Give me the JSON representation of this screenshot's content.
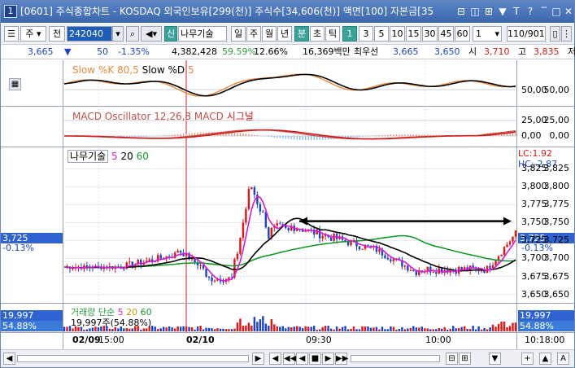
{
  "window": {
    "title_num": "1",
    "title": "[0601] 주식종합차트 - KOSDAQ 외국인보유[299(천)] 주식수[34,606(천)] 액면[100] 자본금[35",
    "buttons": [
      "⊟",
      "◫",
      "⊞",
      "▼",
      "T",
      "?",
      "‾",
      "□",
      "✕"
    ]
  },
  "toolbar": {
    "market": "주",
    "period_label": "전",
    "code": "242040",
    "stock_badge": "신",
    "stock_name": "나무기술",
    "periods": [
      "일",
      "주",
      "월",
      "년",
      "분",
      "초",
      "틱"
    ],
    "period_active": "분",
    "intervals": [
      "1",
      "3",
      "5",
      "10",
      "15",
      "30",
      "45",
      "60"
    ],
    "interval_active": "1",
    "interval_value": "1",
    "bars_shown": "110/901"
  },
  "quote": {
    "price": "3,665",
    "change": "50",
    "change_pct": "-1.35%",
    "volume": "4,382,428",
    "ratio1": "59.59%",
    "ratio2": "12.66%",
    "amount": "16,369백만",
    "priority_label": "최우선",
    "bid1": "3,665",
    "bid2": "3,650",
    "open_label": "시",
    "open": "3,710",
    "high_label": "고",
    "high": "3,835",
    "last_label": "저"
  },
  "colors": {
    "up": "#e0161b",
    "down": "#1a44c8",
    "ma5": "#d61cd0",
    "ma20": "#000000",
    "ma60": "#16992b",
    "stoch_k": "#e88a3a",
    "macd_hist": "#e88a6a",
    "macd_signal": "#d41818",
    "tag_bg": "#2f63d1"
  },
  "stochastic": {
    "legend_name": "Slow %K",
    "legend_k_param": "80,5",
    "legend_d": "Slow %D",
    "legend_d_param": "5",
    "tick_left": "50,00",
    "tick_right": "50,00"
  },
  "macd": {
    "legend": "MACD Oscillator 12,26,8",
    "legend_macd": "MACD",
    "legend_signal": "시그널",
    "ticks": [
      "25,00",
      "0,00"
    ]
  },
  "price_pane": {
    "legend_name": "나무기술",
    "ma_labels": [
      "5",
      "20",
      "60"
    ],
    "lc": "LC:1.92",
    "hc": "HC:-2.87",
    "ticks": [
      "3,825",
      "3,800",
      "3,775",
      "3,750",
      "3,725",
      "3,700",
      "3,675",
      "3,650"
    ],
    "tag_price": "3,725",
    "tag_pct": "-0.13%"
  },
  "volume_pane": {
    "legend": "거래량 단순",
    "ma_labels": [
      "5",
      "20",
      "60"
    ],
    "detail": "19,997주(54.88%)",
    "tag_value": "19,997",
    "tag_pct": "54.88%"
  },
  "time_axis": {
    "labels": [
      "02/09",
      "15:00",
      "02/10",
      "09:30",
      "10:00"
    ],
    "right_time": "10:18:00"
  },
  "bottombar": {
    "buttons": [
      "◀",
      "▶",
      "◀",
      "◀◀",
      "◀",
      "■",
      "▶",
      "▶▶",
      "⊟",
      "⊞",
      "▼",
      "+",
      "▲",
      "A"
    ]
  }
}
